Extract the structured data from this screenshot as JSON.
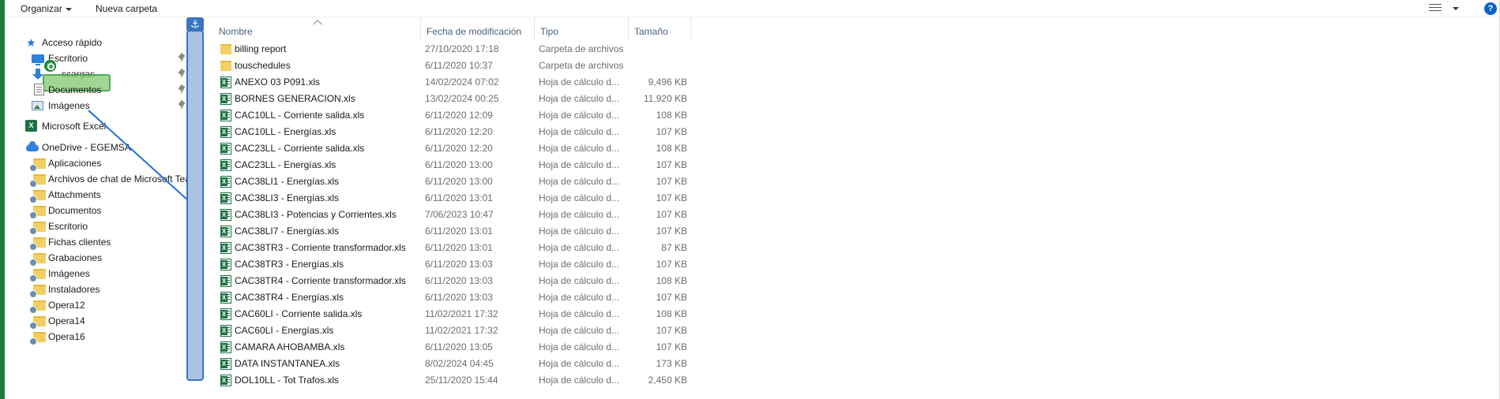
{
  "toolbar": {
    "organize_label": "Organizar",
    "new_folder_label": "Nueva carpeta",
    "view_icon": "details-view-icon",
    "help_label": "?"
  },
  "nav": {
    "quick_access": {
      "label": "Acceso rápido",
      "icon": "star-icon"
    },
    "pinned": [
      {
        "label": "Escritorio",
        "icon": "desktop-icon"
      },
      {
        "label": "scargas",
        "icon": "download-icon"
      },
      {
        "label": "Documentos",
        "icon": "document-icon"
      },
      {
        "label": "Imágenes",
        "icon": "pictures-icon"
      }
    ],
    "excel": {
      "label": "Microsoft Excel",
      "icon": "excel-icon"
    },
    "onedrive": {
      "label": "OneDrive - EGEMSA",
      "icon": "cloud-icon"
    },
    "folders": [
      {
        "label": "Aplicaciones"
      },
      {
        "label": "Archivos de chat de Microsoft Tea"
      },
      {
        "label": "Attachments"
      },
      {
        "label": "Documentos"
      },
      {
        "label": "Escritorio"
      },
      {
        "label": "Fichas clientes"
      },
      {
        "label": "Grabaciones"
      },
      {
        "label": "Imágenes"
      },
      {
        "label": "Instaladores"
      },
      {
        "label": "Opera12"
      },
      {
        "label": "Opera14"
      },
      {
        "label": "Opera16"
      }
    ]
  },
  "drag": {
    "anchor_icon": "⚓"
  },
  "columns": {
    "name": "Nombre",
    "date": "Fecha de modificación",
    "type": "Tipo",
    "size": "Tamaño"
  },
  "files": [
    {
      "name": "billing report",
      "date": "27/10/2020 17:18",
      "type": "Carpeta de archivos",
      "size": "",
      "icon": "folder"
    },
    {
      "name": "touschedules",
      "date": "6/11/2020 10:37",
      "type": "Carpeta de archivos",
      "size": "",
      "icon": "folder"
    },
    {
      "name": "ANEXO 03 P091.xls",
      "date": "14/02/2024 07:02",
      "type": "Hoja de cálculo d...",
      "size": "9,496 KB",
      "icon": "excel"
    },
    {
      "name": "BORNES GENERACION.xls",
      "date": "13/02/2024 00:25",
      "type": "Hoja de cálculo d...",
      "size": "11,920 KB",
      "icon": "excel"
    },
    {
      "name": "CAC10LL - Corriente salida.xls",
      "date": "6/11/2020 12:09",
      "type": "Hoja de cálculo d...",
      "size": "108 KB",
      "icon": "excel"
    },
    {
      "name": "CAC10LL - Energías.xls",
      "date": "6/11/2020 12:20",
      "type": "Hoja de cálculo d...",
      "size": "107 KB",
      "icon": "excel"
    },
    {
      "name": "CAC23LL - Corriente salida.xls",
      "date": "6/11/2020 12:20",
      "type": "Hoja de cálculo d...",
      "size": "108 KB",
      "icon": "excel"
    },
    {
      "name": "CAC23LL - Energías.xls",
      "date": "6/11/2020 13:00",
      "type": "Hoja de cálculo d...",
      "size": "107 KB",
      "icon": "excel"
    },
    {
      "name": "CAC38LI1 - Energías.xls",
      "date": "6/11/2020 13:00",
      "type": "Hoja de cálculo d...",
      "size": "107 KB",
      "icon": "excel"
    },
    {
      "name": "CAC38LI3 - Energías.xls",
      "date": "6/11/2020 13:01",
      "type": "Hoja de cálculo d...",
      "size": "107 KB",
      "icon": "excel"
    },
    {
      "name": "CAC38LI3 - Potencias y Corrientes.xls",
      "date": "7/06/2023 10:47",
      "type": "Hoja de cálculo d...",
      "size": "107 KB",
      "icon": "excel"
    },
    {
      "name": "CAC38LI7 - Energías.xls",
      "date": "6/11/2020 13:01",
      "type": "Hoja de cálculo d...",
      "size": "107 KB",
      "icon": "excel"
    },
    {
      "name": "CAC38TR3 - Corriente transformador.xls",
      "date": "6/11/2020 13:01",
      "type": "Hoja de cálculo d...",
      "size": "87 KB",
      "icon": "excel"
    },
    {
      "name": "CAC38TR3 - Energías.xls",
      "date": "6/11/2020 13:03",
      "type": "Hoja de cálculo d...",
      "size": "107 KB",
      "icon": "excel"
    },
    {
      "name": "CAC38TR4 - Corriente transformador.xls",
      "date": "6/11/2020 13:03",
      "type": "Hoja de cálculo d...",
      "size": "108 KB",
      "icon": "excel"
    },
    {
      "name": "CAC38TR4 - Energías.xls",
      "date": "6/11/2020 13:03",
      "type": "Hoja de cálculo d...",
      "size": "107 KB",
      "icon": "excel"
    },
    {
      "name": "CAC60LI - Corriente salida.xls",
      "date": "11/02/2021 17:32",
      "type": "Hoja de cálculo d...",
      "size": "108 KB",
      "icon": "excel"
    },
    {
      "name": "CAC60LI - Energías.xls",
      "date": "11/02/2021 17:32",
      "type": "Hoja de cálculo d...",
      "size": "107 KB",
      "icon": "excel"
    },
    {
      "name": "CAMARA AHOBAMBA.xls",
      "date": "6/11/2020 13:05",
      "type": "Hoja de cálculo d...",
      "size": "107 KB",
      "icon": "excel"
    },
    {
      "name": "DATA INSTANTANEA.xls",
      "date": "8/02/2024 04:45",
      "type": "Hoja de cálculo d...",
      "size": "173 KB",
      "icon": "excel"
    },
    {
      "name": "DOL10LL - Tot Trafos.xls",
      "date": "25/11/2020 15:44",
      "type": "Hoja de cálculo d...",
      "size": "2,450 KB",
      "icon": "excel"
    }
  ],
  "colors": {
    "accent_green": "#1e7b3e",
    "drag_blue": "#3b74c2",
    "folder_yellow": "#f2cf64",
    "excel_green": "#1e7145"
  }
}
